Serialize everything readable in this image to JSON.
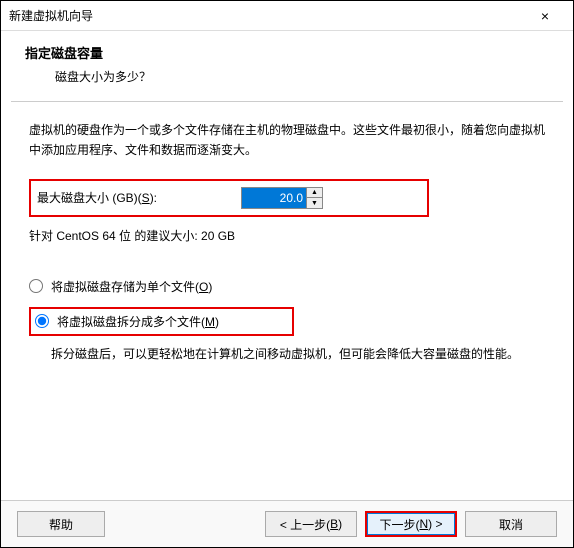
{
  "window": {
    "title": "新建虚拟机向导",
    "close_icon": "×"
  },
  "header": {
    "heading": "指定磁盘容量",
    "subheading": "磁盘大小为多少？"
  },
  "content": {
    "description": "虚拟机的硬盘作为一个或多个文件存储在主机的物理磁盘中。这些文件最初很小，随着您向虚拟机中添加应用程序、文件和数据而逐渐变大。",
    "disk_label_prefix": "最大磁盘大小 (GB)(",
    "disk_label_key": "S",
    "disk_label_suffix": "):",
    "disk_value": "20.0",
    "recommend": "针对 CentOS 64 位 的建议大小: 20 GB",
    "radio1_prefix": "将虚拟磁盘存储为单个文件(",
    "radio1_key": "O",
    "radio1_suffix": ")",
    "radio2_prefix": "将虚拟磁盘拆分成多个文件(",
    "radio2_key": "M",
    "radio2_suffix": ")",
    "split_desc": "拆分磁盘后，可以更轻松地在计算机之间移动虚拟机，但可能会降低大容量磁盘的性能。"
  },
  "footer": {
    "help": "帮助",
    "back_prefix": "< 上一步(",
    "back_key": "B",
    "back_suffix": ")",
    "next_prefix": "下一步(",
    "next_key": "N",
    "next_suffix": ") >",
    "cancel": "取消"
  }
}
